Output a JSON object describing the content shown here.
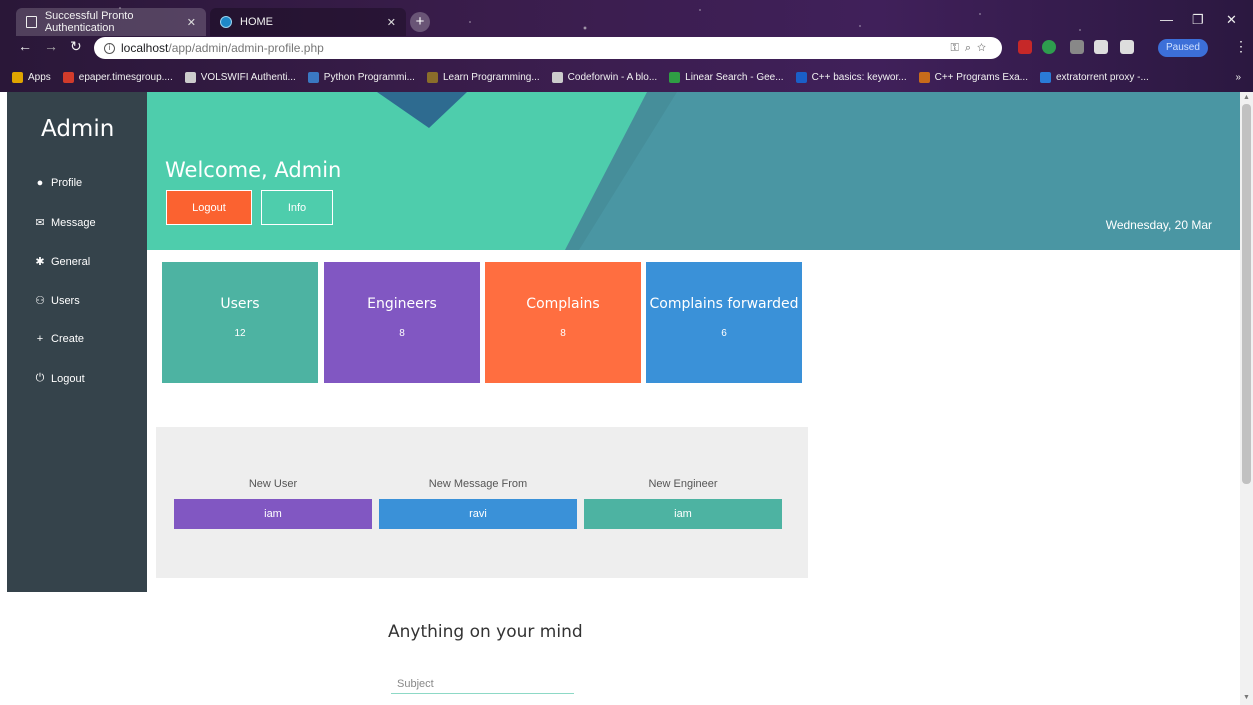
{
  "browser": {
    "tabs": [
      {
        "title": "Successful Pronto Authentication"
      },
      {
        "title": "HOME"
      }
    ],
    "url_host": "localhost",
    "url_path": "/app/admin/admin-profile.php",
    "profile_status": "Paused",
    "bookmarks": [
      {
        "label": "Apps",
        "color": "#e0a400"
      },
      {
        "label": "epaper.timesgroup....",
        "color": "#d23b2b"
      },
      {
        "label": "VOLSWIFI Authenti...",
        "color": "#cccccc"
      },
      {
        "label": "Python Programmi...",
        "color": "#3a78c2"
      },
      {
        "label": "Learn Programming...",
        "color": "#8a6d2a"
      },
      {
        "label": "Codeforwin - A blo...",
        "color": "#cccccc"
      },
      {
        "label": "Linear Search - Gee...",
        "color": "#2f9e44"
      },
      {
        "label": "C++ basics: keywor...",
        "color": "#1a5fc8"
      },
      {
        "label": "C++ Programs Exa...",
        "color": "#c86b1a"
      },
      {
        "label": "extratorrent proxy -...",
        "color": "#2a7bd8"
      }
    ]
  },
  "sidebar": {
    "title": "Admin",
    "items": [
      {
        "label": "Profile",
        "icon": "user-circle-icon",
        "glyph": "●"
      },
      {
        "label": "Message",
        "icon": "envelope-open-icon",
        "glyph": "✉"
      },
      {
        "label": "General",
        "icon": "cog-icon",
        "glyph": "✱"
      },
      {
        "label": "Users",
        "icon": "users-icon",
        "glyph": "⚇"
      },
      {
        "label": "Create",
        "icon": "plus-icon",
        "glyph": "+"
      },
      {
        "label": "Logout",
        "icon": "power-icon",
        "glyph": "⏻"
      }
    ]
  },
  "hero": {
    "welcome": "Welcome, Admin",
    "logout_label": "Logout",
    "info_label": "Info",
    "date": "Wednesday, 20 Mar"
  },
  "stats": [
    {
      "title": "Users",
      "value": "12",
      "color": "#4db3a2"
    },
    {
      "title": "Engineers",
      "value": "8",
      "color": "#8157c2"
    },
    {
      "title": "Complains",
      "value": "8",
      "color": "#ff6e40"
    },
    {
      "title": "Complains forwarded",
      "value": "6",
      "color": "#3a91d8"
    }
  ],
  "recent": [
    {
      "label": "New User",
      "value": "iam",
      "color": "#8157c2"
    },
    {
      "label": "New Message From",
      "value": "ravi",
      "color": "#3a91d8"
    },
    {
      "label": "New Engineer",
      "value": "iam",
      "color": "#4db3a2"
    }
  ],
  "feedback": {
    "heading": "Anything on your mind",
    "subject_placeholder": "Subject"
  }
}
